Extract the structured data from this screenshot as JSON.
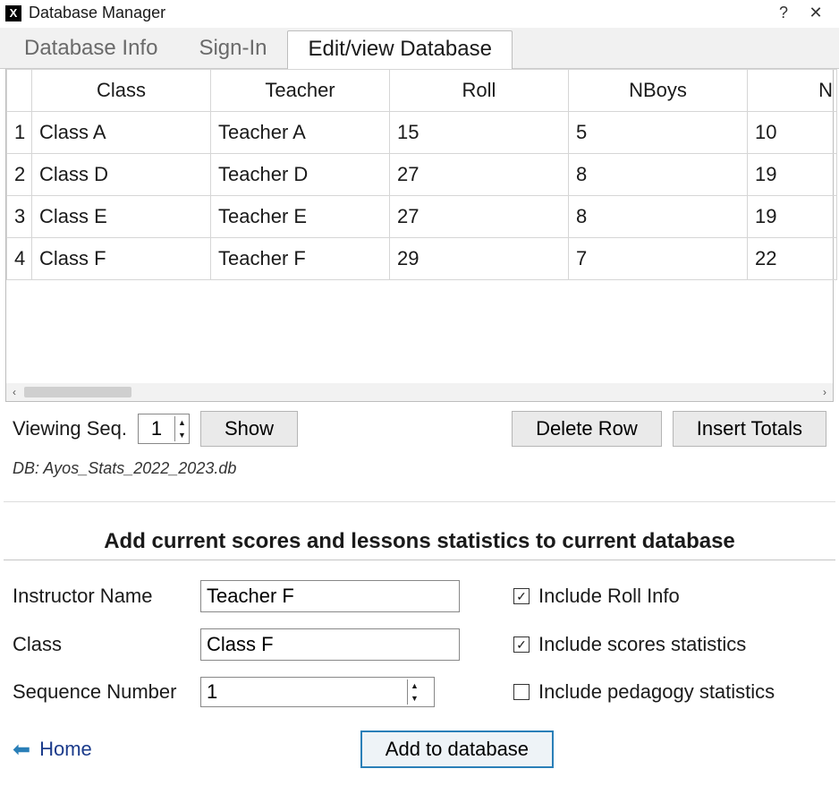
{
  "window": {
    "title": "Database Manager"
  },
  "tabs": {
    "items": [
      "Database Info",
      "Sign-In",
      "Edit/view Database"
    ],
    "active_index": 2
  },
  "table": {
    "columns": [
      "Class",
      "Teacher",
      "Roll",
      "NBoys",
      "N"
    ],
    "rows": [
      {
        "n": "1",
        "cells": [
          "Class A",
          "Teacher A",
          "15",
          "5",
          "10"
        ]
      },
      {
        "n": "2",
        "cells": [
          "Class D",
          "Teacher D",
          "27",
          "8",
          "19"
        ]
      },
      {
        "n": "3",
        "cells": [
          "Class E",
          "Teacher E",
          "27",
          "8",
          "19"
        ]
      },
      {
        "n": "4",
        "cells": [
          "Class F",
          "Teacher F",
          "29",
          "7",
          "22"
        ]
      }
    ]
  },
  "controls": {
    "viewing_seq_label": "Viewing Seq.",
    "viewing_seq_value": "1",
    "show_label": "Show",
    "delete_row_label": "Delete Row",
    "insert_totals_label": "Insert Totals"
  },
  "db_line": "DB: Ayos_Stats_2022_2023.db",
  "section_title": "Add current scores and lessons statistics to current database",
  "form": {
    "instructor_label": "Instructor Name",
    "instructor_value": "Teacher F",
    "class_label": "Class",
    "class_value": "Class F",
    "seq_label": "Sequence Number",
    "seq_value": "1",
    "chk_roll": "Include Roll Info",
    "chk_scores": "Include  scores statistics",
    "chk_pedagogy": "Include pedagogy statistics",
    "chk_roll_checked": true,
    "chk_scores_checked": true,
    "chk_pedagogy_checked": false,
    "add_label": "Add to database"
  },
  "home_label": "Home"
}
